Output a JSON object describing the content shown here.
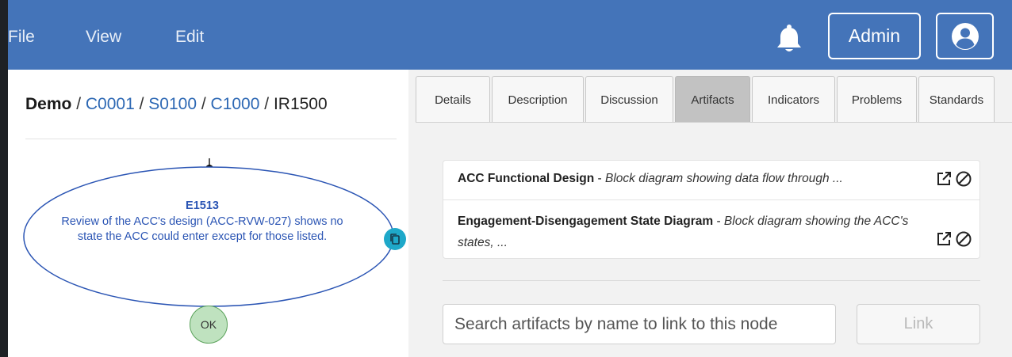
{
  "menu": {
    "file": "File",
    "view": "View",
    "edit": "Edit"
  },
  "header": {
    "admin_label": "Admin",
    "icons": [
      "bell-icon",
      "user-avatar-icon"
    ]
  },
  "breadcrumb": {
    "root": "Demo",
    "links": [
      "C0001",
      "S0100",
      "C1000"
    ],
    "current": "IR1500",
    "separator": "/"
  },
  "node": {
    "id": "E1513",
    "text": "Review of the ACC's design (ACC-RVW-027) shows no state the ACC could enter except for those listed.",
    "ok_label": "OK",
    "icons": [
      "copy-icon"
    ]
  },
  "tabs": [
    {
      "label": "Details"
    },
    {
      "label": "Description"
    },
    {
      "label": "Discussion"
    },
    {
      "label": "Artifacts"
    },
    {
      "label": "Indicators"
    },
    {
      "label": "Problems"
    },
    {
      "label": "Standards"
    }
  ],
  "active_tab": "Artifacts",
  "artifacts": [
    {
      "name": "ACC Functional Design",
      "separator": " - ",
      "description": "Block diagram showing data flow through ..."
    },
    {
      "name": "Engagement-Disengagement State Diagram",
      "separator": " - ",
      "description": "Block diagram showing the ACC's states, ..."
    }
  ],
  "artifact_actions": [
    "open-external-icon",
    "unlink-icon"
  ],
  "search": {
    "placeholder": "Search artifacts by name to link to this node",
    "value": "",
    "link_label": "Link"
  },
  "colors": {
    "topbar": "#4474b9",
    "link": "#2d68b4",
    "node_stroke": "#2b55b4",
    "copy_button": "#1ea8c9",
    "ok_fill": "#bfe2bf",
    "active_tab": "#c2c2c2"
  }
}
